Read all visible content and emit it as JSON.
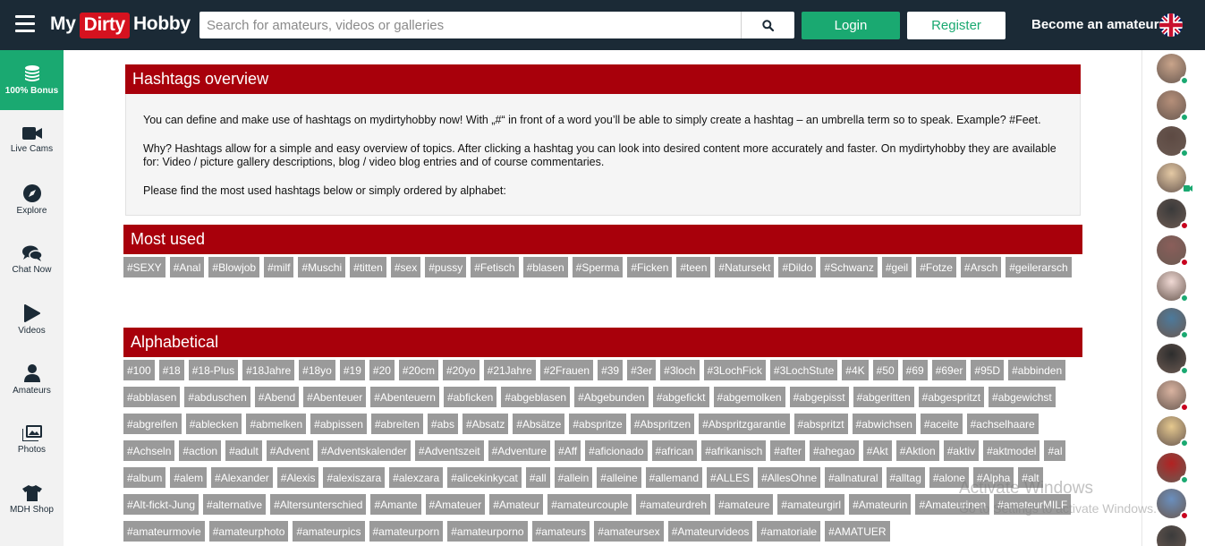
{
  "header": {
    "logo": {
      "part1": "My",
      "part2": "Dirty",
      "part3": "Hobby"
    },
    "search_placeholder": "Search for amateurs, videos or galleries",
    "login": "Login",
    "register": "Register",
    "become": "Become an amateur"
  },
  "sidebar": [
    {
      "label": "100% Bonus",
      "icon": "coins-icon"
    },
    {
      "label": "Live Cams",
      "icon": "camera-icon"
    },
    {
      "label": "Explore",
      "icon": "compass-icon"
    },
    {
      "label": "Chat Now",
      "icon": "chat-icon"
    },
    {
      "label": "Videos",
      "icon": "play-icon"
    },
    {
      "label": "Amateurs",
      "icon": "user-icon"
    },
    {
      "label": "Photos",
      "icon": "photos-icon"
    },
    {
      "label": "MDH Shop",
      "icon": "shirt-icon"
    }
  ],
  "overview": {
    "title": "Hashtags overview",
    "p1": "You can define and make use of hashtags on mydirtyhobby now! With „#“ in front of a word you’ll be able to simply create a hashtag – an umbrella term so to speak. Example? #Feet.",
    "p2": "Why? Hashtags allow for a simple and easy overview of topics. After clicking a hashtag you can look into desired content more accurately and faster. On mydirtyhobby they are available for: Video / picture gallery descriptions, blog / video blog entries and of course commentaries.",
    "p3": "Please find the most used hashtags below or simply ordered by alphabet:"
  },
  "most_used": {
    "title": "Most used",
    "tags": [
      "#SEXY",
      "#Anal",
      "#Blowjob",
      "#milf",
      "#Muschi",
      "#titten",
      "#sex",
      "#pussy",
      "#Fetisch",
      "#blasen",
      "#Sperma",
      "#Ficken",
      "#teen",
      "#Natursekt",
      "#Dildo",
      "#Schwanz",
      "#geil",
      "#Fotze",
      "#Arsch",
      "#geilerarsch"
    ]
  },
  "alphabetical": {
    "title": "Alphabetical",
    "tags": [
      "#100",
      "#18",
      "#18-Plus",
      "#18Jahre",
      "#18yo",
      "#19",
      "#20",
      "#20cm",
      "#20yo",
      "#21Jahre",
      "#2Frauen",
      "#39",
      "#3er",
      "#3loch",
      "#3LochFick",
      "#3LochStute",
      "#4K",
      "#50",
      "#69",
      "#69er",
      "#95D",
      "#abbinden",
      "#abblasen",
      "#abduschen",
      "#Abend",
      "#Abenteuer",
      "#Abenteuern",
      "#abficken",
      "#abgeblasen",
      "#Abgebunden",
      "#abgefickt",
      "#abgemolken",
      "#abgepisst",
      "#abgeritten",
      "#abgespritzt",
      "#abgewichst",
      "#abgreifen",
      "#ablecken",
      "#abmelken",
      "#abpissen",
      "#abreiten",
      "#abs",
      "#Absatz",
      "#Absätze",
      "#abspritze",
      "#Abspritzen",
      "#Abspritzgarantie",
      "#abspritzt",
      "#abwichsen",
      "#aceite",
      "#achselhaare",
      "#Achseln",
      "#action",
      "#adult",
      "#Advent",
      "#Adventskalender",
      "#Adventszeit",
      "#Adventure",
      "#Aff",
      "#aficionado",
      "#african",
      "#afrikanisch",
      "#after",
      "#ahegao",
      "#Akt",
      "#Aktion",
      "#aktiv",
      "#aktmodel",
      "#al",
      "#album",
      "#alem",
      "#Alexander",
      "#Alexis",
      "#alexiszara",
      "#alexzara",
      "#alicekinkycat",
      "#all",
      "#allein",
      "#alleine",
      "#allemand",
      "#ALLES",
      "#AllesOhne",
      "#allnatural",
      "#alltag",
      "#alone",
      "#Alpha",
      "#alt",
      "#Alt-fickt-Jung",
      "#alternative",
      "#Altersunterschied",
      "#Amante",
      "#Amateuer",
      "#Amateur",
      "#amateurcouple",
      "#amateurdreh",
      "#amateure",
      "#amateurgirl",
      "#Amateurin",
      "#Amateurinen",
      "#amateurMILF",
      "#amateurmovie",
      "#amateurphoto",
      "#amateurpics",
      "#amateurporn",
      "#amateurporno",
      "#amateurs",
      "#amateursex",
      "#Amateurvideos",
      "#amatoriale",
      "#AMATUER"
    ]
  },
  "rail": {
    "avatars": [
      {
        "color": "#c9a48a",
        "status": "#1aa971"
      },
      {
        "color": "#b58f79",
        "status": "#1aa971"
      },
      {
        "color": "#5d4a43",
        "status": "#1aa971"
      },
      {
        "color": "#e4c9a4",
        "status": "cam"
      },
      {
        "color": "#3a3a3a",
        "status": "#c8001e"
      },
      {
        "color": "#8a5e5a",
        "status": "#c8001e"
      },
      {
        "color": "#f0d9d4",
        "status": "#1aa971"
      },
      {
        "color": "#4c7a9c",
        "status": "#1aa971"
      },
      {
        "color": "#2d2d2d",
        "status": "#1aa971"
      },
      {
        "color": "#d9b3a0",
        "status": "#c8001e"
      },
      {
        "color": "#e5c88e",
        "status": "#1aa971"
      },
      {
        "color": "#b22222",
        "status": "#1aa971"
      },
      {
        "color": "#6a8fbe",
        "status": "#c8001e"
      },
      {
        "color": "#3b3b3b",
        "status": "#1aa971"
      }
    ]
  },
  "watermark": {
    "line1": "Activate Windows",
    "line2": "Go to Settings to activate Windows."
  }
}
